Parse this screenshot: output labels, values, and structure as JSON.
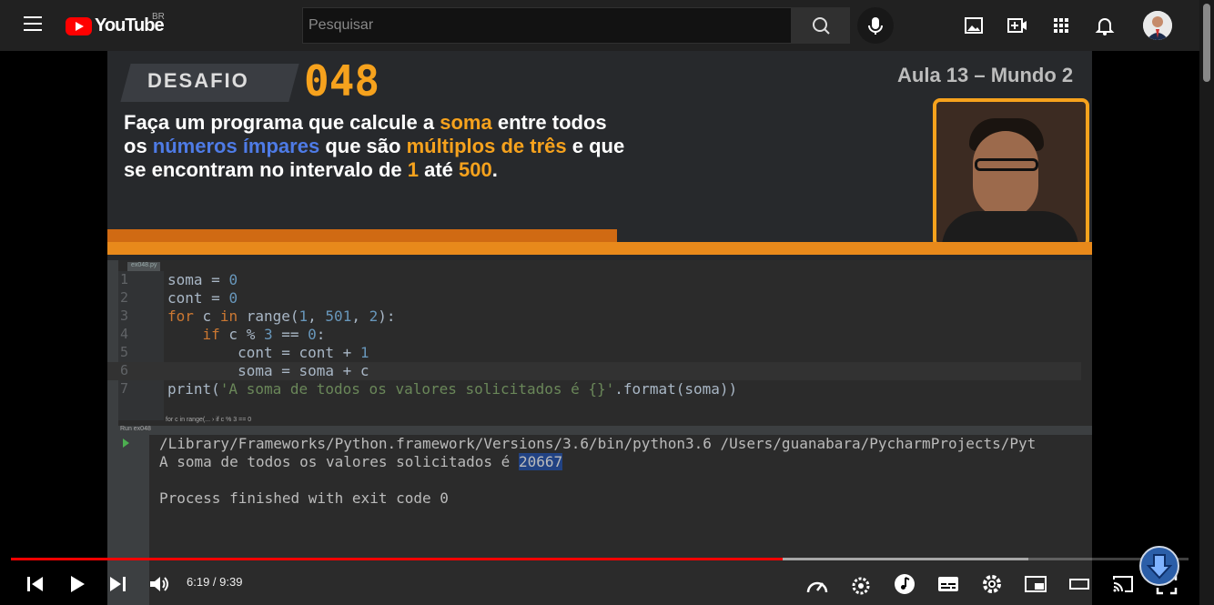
{
  "header": {
    "logo_text": "YouTube",
    "country_code": "BR",
    "search_placeholder": "Pesquisar"
  },
  "video": {
    "banner": {
      "tag": "DESAFIO",
      "number": "048",
      "lesson": "Aula 13 – Mundo 2",
      "description_parts": [
        "Faça um programa que calcule a ",
        "soma",
        " entre todos os ",
        "números ímpares",
        " que são ",
        "múltiplos de três",
        " e que se encontram no intervalo de ",
        "1",
        " até ",
        "500",
        "."
      ]
    },
    "ide": {
      "tab_name": "ex048.py",
      "line_numbers": [
        "1",
        "2",
        "3",
        "4",
        "5",
        "6",
        "7"
      ],
      "breadcrumb": "for c in range(...    ›  if c % 3 == 0",
      "run_label": "Run  ex048",
      "output_lines": [
        "/Library/Frameworks/Python.framework/Versions/3.6/bin/python3.6 /Users/guanabara/PycharmProjects/Pyt",
        "A soma de todos os valores solicitados é ",
        "",
        "Process finished with exit code 0"
      ],
      "output_result": "20667"
    }
  },
  "player": {
    "time_display": "6:19 / 9:39",
    "progress_fraction": 0.655,
    "icons": [
      "previous-icon",
      "play-icon",
      "next-icon",
      "volume-icon",
      "speed-icon",
      "settings-gear-icon",
      "music-icon",
      "subtitles-icon",
      "settings-icon",
      "miniplayer-icon",
      "theater-icon",
      "cast-icon",
      "fullscreen-icon"
    ]
  },
  "colors": {
    "accent_red": "#ff0000",
    "banner_orange": "#f6a21d",
    "banner_blue": "#4e7be6"
  }
}
